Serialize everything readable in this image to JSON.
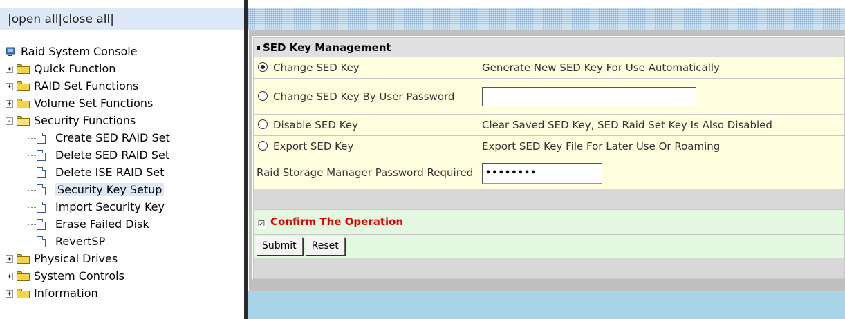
{
  "nav": {
    "open_close": "|open all|close all|",
    "root": "Raid System Console",
    "items": [
      {
        "label": "Quick Function",
        "expander": "+"
      },
      {
        "label": "RAID Set Functions",
        "expander": "+"
      },
      {
        "label": "Volume Set Functions",
        "expander": "+"
      },
      {
        "label": "Security Functions",
        "expander": "-"
      }
    ],
    "security_children": [
      {
        "label": "Create SED RAID Set"
      },
      {
        "label": "Delete SED RAID Set"
      },
      {
        "label": "Delete ISE RAID Set"
      },
      {
        "label": "Security Key Setup"
      },
      {
        "label": "Import Security Key"
      },
      {
        "label": "Erase Failed Disk"
      },
      {
        "label": "RevertSP"
      }
    ],
    "items_after": [
      {
        "label": "Physical Drives",
        "expander": "+"
      },
      {
        "label": "System Controls",
        "expander": "+"
      },
      {
        "label": "Information",
        "expander": "+"
      }
    ]
  },
  "form": {
    "title": "SED Key Management",
    "options": [
      {
        "label": "Change SED Key",
        "desc": "Generate New SED Key For Use Automatically",
        "selected": true
      },
      {
        "label": "Change SED Key By User Password",
        "desc": "",
        "selected": false
      },
      {
        "label": "Disable SED Key",
        "desc": "Clear Saved SED Key, SED Raid Set Key Is Also Disabled",
        "selected": false
      },
      {
        "label": "Export SED Key",
        "desc": "Export SED Key File For Later Use Or Roaming",
        "selected": false
      }
    ],
    "password_label": "Raid Storage Manager Password Required",
    "password_value": "••••••••",
    "confirm_mark": "☑",
    "confirm_label": "Confirm The Operation",
    "submit_label": "Submit",
    "reset_label": "Reset"
  }
}
